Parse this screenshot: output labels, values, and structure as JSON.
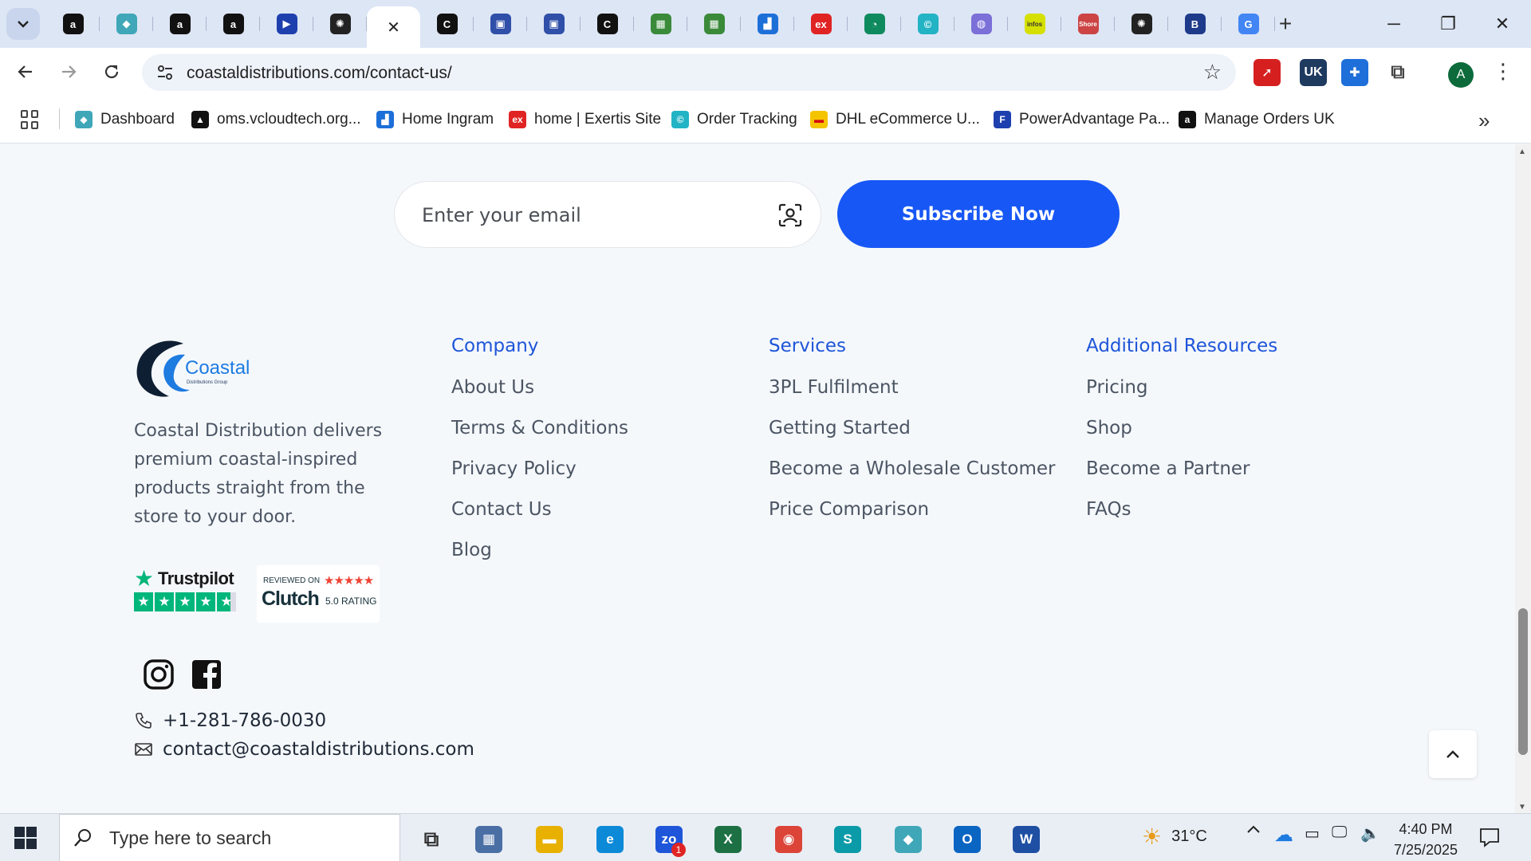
{
  "browser": {
    "url": "coastaldistributions.com/contact-us/",
    "active_tab_close": "✕",
    "tabs": [
      {
        "icon": "a",
        "color": "#111111"
      },
      {
        "icon": "◆",
        "color": "#3fa7b8"
      },
      {
        "icon": "a",
        "color": "#111111"
      },
      {
        "icon": "a",
        "color": "#111111"
      },
      {
        "icon": "▶",
        "color": "#1e40af"
      },
      {
        "icon": "✺",
        "color": "#222222"
      },
      {
        "icon": "✕",
        "color": "#ffffff"
      },
      {
        "icon": "C",
        "color": "#111111"
      },
      {
        "icon": "▣",
        "color": "#2f4fa8"
      },
      {
        "icon": "▣",
        "color": "#2f4fa8"
      },
      {
        "icon": "C",
        "color": "#111111"
      },
      {
        "icon": "▦",
        "color": "#3a8a3a"
      },
      {
        "icon": "▦",
        "color": "#3a8a3a"
      },
      {
        "icon": "▟",
        "color": "#1d6fd8"
      },
      {
        "icon": "ex",
        "color": "#e02424"
      },
      {
        "icon": "◔",
        "color": "#0f8a5f"
      },
      {
        "icon": "©",
        "color": "#22b3c4"
      },
      {
        "icon": "◍",
        "color": "#7b6fd8"
      },
      {
        "icon": "infos",
        "color": "#d6e000"
      },
      {
        "icon": "Shore",
        "color": "#cc4444"
      },
      {
        "icon": "✺",
        "color": "#222222"
      },
      {
        "icon": "B",
        "color": "#1e3a8a"
      },
      {
        "icon": "G",
        "color": "#4285f4"
      }
    ],
    "new_tab": "+",
    "window": {
      "minimize": "─",
      "restore": "❐",
      "close": "✕"
    },
    "extensions": [
      {
        "name": "pdf",
        "glyph": "➚",
        "color": "#d62020"
      },
      {
        "name": "vpn-uk",
        "glyph": "UK",
        "color": "#1e3a5f"
      },
      {
        "name": "puzzle-alt",
        "glyph": "✚",
        "color": "#1e6fd9"
      },
      {
        "name": "extensions",
        "glyph": "⧉",
        "color": "#444444"
      }
    ],
    "profile_initial": "A",
    "menu_glyph": "⋮",
    "bookmarks": [
      {
        "label": "Dashboard",
        "icon": "◆",
        "color": "#3fa7b8"
      },
      {
        "label": "oms.vcloudtech.org...",
        "icon": "▲",
        "color": "#111111"
      },
      {
        "label": "Home Ingram",
        "icon": "▟",
        "color": "#1d6fd8"
      },
      {
        "label": "home | Exertis Site",
        "icon": "ex",
        "color": "#e02424"
      },
      {
        "label": "Order Tracking",
        "icon": "©",
        "color": "#22b3c4"
      },
      {
        "label": "DHL eCommerce U...",
        "icon": "▬",
        "color": "#f5c400"
      },
      {
        "label": "PowerAdvantage Pa...",
        "icon": "F",
        "color": "#1e40af"
      },
      {
        "label": "Manage Orders UK",
        "icon": "a",
        "color": "#111111"
      }
    ],
    "bookmarks_more": "»"
  },
  "newsletter": {
    "email_placeholder": "Enter your email",
    "subscribe_label": "Subscribe Now"
  },
  "footer": {
    "brand": {
      "name": "Coastal",
      "tagline": "Distributions Group",
      "description": "Coastal Distribution delivers premium coastal-inspired products straight from the store to your door."
    },
    "columns": [
      {
        "title": "Company",
        "links": [
          "About Us",
          "Terms & Conditions",
          "Privacy Policy",
          "Contact Us",
          "Blog"
        ]
      },
      {
        "title": "Services",
        "links": [
          "3PL Fulfilment",
          "Getting Started",
          "Become a Wholesale Customer",
          "Price Comparison"
        ]
      },
      {
        "title": "Additional Resources",
        "links": [
          "Pricing",
          "Shop",
          "Become a Partner",
          "FAQs"
        ]
      }
    ],
    "badges": {
      "trustpilot": "Trustpilot",
      "trustpilot_stars": 5,
      "clutch_reviewed": "REVIEWED ON",
      "clutch": "Clutch",
      "clutch_rating": "5.0 RATING",
      "clutch_stars": "★★★★★"
    },
    "phone": "+1-281-786-0030",
    "email": "contact@coastaldistributions.com"
  },
  "taskbar": {
    "search_placeholder": "Type here to search",
    "apps": [
      {
        "name": "task-view",
        "glyph": "⧉",
        "color": "#333333"
      },
      {
        "name": "calculator",
        "glyph": "▦",
        "color": "#4a6fa5"
      },
      {
        "name": "file-explorer",
        "glyph": "▬",
        "color": "#e8b000"
      },
      {
        "name": "edge",
        "glyph": "e",
        "color": "#0c8ad8"
      },
      {
        "name": "zoho",
        "glyph": "zo",
        "color": "#1e55d9",
        "badge": "1"
      },
      {
        "name": "excel",
        "glyph": "X",
        "color": "#1d7044"
      },
      {
        "name": "chrome",
        "glyph": "◉",
        "color": "#db4437"
      },
      {
        "name": "app-s",
        "glyph": "S",
        "color": "#0b9aa8"
      },
      {
        "name": "app-diamond",
        "glyph": "◆",
        "color": "#3fa7b8"
      },
      {
        "name": "outlook",
        "glyph": "O",
        "color": "#0a64c2"
      },
      {
        "name": "word",
        "glyph": "W",
        "color": "#1e4fa3"
      }
    ],
    "weather": "31°C",
    "time": "4:40 PM",
    "date": "7/25/2025"
  }
}
